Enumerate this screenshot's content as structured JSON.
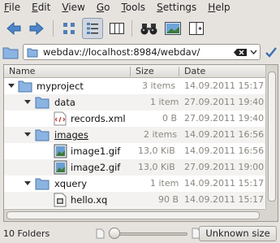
{
  "menubar": {
    "items": [
      {
        "label": "File"
      },
      {
        "label": "Edit"
      },
      {
        "label": "View"
      },
      {
        "label": "Go"
      },
      {
        "label": "Tools"
      },
      {
        "label": "Settings"
      },
      {
        "label": "Help"
      }
    ]
  },
  "toolbar": {
    "buttons": [
      "back-icon",
      "forward-icon",
      "icons-view-icon",
      "details-view-icon",
      "columns-view-icon",
      "find-icon",
      "preview-icon",
      "split-view-icon"
    ]
  },
  "location": {
    "url": "webdav://localhost:8984/webdav/"
  },
  "columns": {
    "name": "Name",
    "size": "Size",
    "date": "Date"
  },
  "rows": [
    {
      "name": "myproject",
      "size": "3 items",
      "date": "14.09.2011 15:17",
      "type": "folder",
      "depth": 0,
      "expanded": true
    },
    {
      "name": "data",
      "size": "1 item",
      "date": "27.09.2011 19:40",
      "type": "folder",
      "depth": 1,
      "expanded": true
    },
    {
      "name": "records.xml",
      "size": "0 B",
      "date": "27.09.2011 19:40",
      "type": "xml",
      "depth": 2
    },
    {
      "name": "images",
      "size": "2 items",
      "date": "14.09.2011 16:56",
      "type": "folder",
      "depth": 1,
      "expanded": true
    },
    {
      "name": "image1.gif",
      "size": "13,0 KiB",
      "date": "14.09.2011 16:56",
      "type": "image",
      "depth": 2
    },
    {
      "name": "image2.gif",
      "size": "13,0 KiB",
      "date": "27.09.2011 19:00",
      "type": "image",
      "depth": 2
    },
    {
      "name": "xquery",
      "size": "1 item",
      "date": "14.09.2011 15:17",
      "type": "folder",
      "depth": 1,
      "expanded": true
    },
    {
      "name": "hello.xq",
      "size": "90 B",
      "date": "14.09.2011 15:17",
      "type": "script",
      "depth": 2
    }
  ],
  "statusbar": {
    "summary": "10 Folders",
    "size_button": "Unknown size"
  },
  "colors": {
    "folder": "#7ea6d8",
    "selection_accent": "#cfd6df"
  }
}
